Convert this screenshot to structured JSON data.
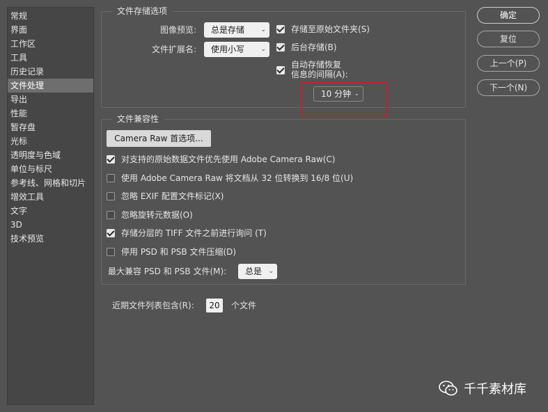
{
  "sidebar": {
    "items": [
      {
        "label": "常规"
      },
      {
        "label": "界面"
      },
      {
        "label": "工作区"
      },
      {
        "label": "工具"
      },
      {
        "label": "历史记录"
      },
      {
        "label": "文件处理",
        "active": true
      },
      {
        "label": "导出"
      },
      {
        "label": "性能"
      },
      {
        "label": "暂存盘"
      },
      {
        "label": "光标"
      },
      {
        "label": "透明度与色域"
      },
      {
        "label": "单位与标尺"
      },
      {
        "label": "参考线、网格和切片"
      },
      {
        "label": "增效工具"
      },
      {
        "label": "文字"
      },
      {
        "label": "3D"
      },
      {
        "label": "技术预览"
      }
    ]
  },
  "file_save": {
    "title": "文件存储选项",
    "image_preview_label": "图像预览:",
    "image_preview_value": "总是存储",
    "file_ext_label": "文件扩展名:",
    "file_ext_value": "使用小写",
    "save_original_folder": {
      "label": "存储至原始文件夹(S)",
      "checked": true
    },
    "background_save": {
      "label": "后台存储(B)",
      "checked": true
    },
    "autosave": {
      "label_line1": "自动存储恢复",
      "label_line2": "信息的间隔(A):",
      "checked": true
    },
    "autosave_interval": "10 分钟"
  },
  "compat": {
    "title": "文件兼容性",
    "camera_raw_button": "Camera Raw 首选项...",
    "options": [
      {
        "label": "对支持的原始数据文件优先使用 Adobe Camera Raw(C)",
        "checked": true
      },
      {
        "label": "使用 Adobe Camera Raw 将文档从 32 位转换到 16/8 位(U)",
        "checked": false
      },
      {
        "label": "忽略 EXIF 配置文件标记(X)",
        "checked": false
      },
      {
        "label": "忽略旋转元数据(O)",
        "checked": false
      },
      {
        "label": "存储分层的 TIFF 文件之前进行询问 (T)",
        "checked": true
      },
      {
        "label": "停用 PSD 和 PSB 文件压缩(D)",
        "checked": false
      }
    ],
    "max_compat_label": "最大兼容 PSD 和 PSB 文件(M):",
    "max_compat_value": "总是"
  },
  "recent": {
    "label": "近期文件列表包含(R):",
    "value": "20",
    "suffix": "个文件"
  },
  "buttons": {
    "ok": "确定",
    "reset": "复位",
    "prev": "上一个(P)",
    "next": "下一个(N)"
  },
  "watermark": {
    "text": "千千素材库"
  }
}
